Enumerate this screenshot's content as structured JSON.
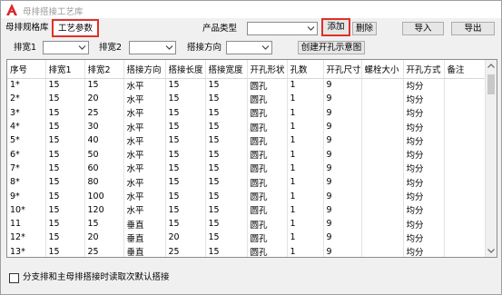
{
  "window": {
    "title": "母排搭接工艺库"
  },
  "tabs": [
    {
      "label": "母排规格库"
    },
    {
      "label": "工艺参数"
    }
  ],
  "toolbar": {
    "product_type_label": "产品类型",
    "product_type_value": "",
    "add_label": "添加",
    "delete_label": "删除",
    "import_label": "导入",
    "export_label": "导出"
  },
  "filters": {
    "width1_label": "排宽1",
    "width2_label": "排宽2",
    "direction_label": "搭接方向",
    "diagram_button": "创建开孔示意图"
  },
  "table": {
    "headers": [
      "序号",
      "排宽1",
      "排宽2",
      "搭接方向",
      "搭接长度",
      "搭接宽度",
      "开孔形状",
      "孔数",
      "开孔尺寸",
      "螺栓大小",
      "开孔方式",
      "备注"
    ],
    "rows": [
      [
        "1*",
        "15",
        "15",
        "水平",
        "15",
        "15",
        "圆孔",
        "1",
        "9",
        "",
        "均分",
        ""
      ],
      [
        "2*",
        "15",
        "20",
        "水平",
        "15",
        "15",
        "圆孔",
        "1",
        "9",
        "",
        "均分",
        ""
      ],
      [
        "3*",
        "15",
        "25",
        "水平",
        "15",
        "15",
        "圆孔",
        "1",
        "9",
        "",
        "均分",
        ""
      ],
      [
        "4*",
        "15",
        "30",
        "水平",
        "15",
        "15",
        "圆孔",
        "1",
        "9",
        "",
        "均分",
        ""
      ],
      [
        "5*",
        "15",
        "40",
        "水平",
        "15",
        "15",
        "圆孔",
        "1",
        "9",
        "",
        "均分",
        ""
      ],
      [
        "6*",
        "15",
        "50",
        "水平",
        "15",
        "15",
        "圆孔",
        "1",
        "9",
        "",
        "均分",
        ""
      ],
      [
        "7*",
        "15",
        "60",
        "水平",
        "15",
        "15",
        "圆孔",
        "1",
        "9",
        "",
        "均分",
        ""
      ],
      [
        "8*",
        "15",
        "80",
        "水平",
        "15",
        "15",
        "圆孔",
        "1",
        "9",
        "",
        "均分",
        ""
      ],
      [
        "9*",
        "15",
        "100",
        "水平",
        "15",
        "15",
        "圆孔",
        "1",
        "9",
        "",
        "均分",
        ""
      ],
      [
        "10*",
        "15",
        "120",
        "水平",
        "15",
        "15",
        "圆孔",
        "1",
        "9",
        "",
        "均分",
        ""
      ],
      [
        "11",
        "15",
        "15",
        "垂直",
        "15",
        "15",
        "圆孔",
        "1",
        "9",
        "",
        "均分",
        ""
      ],
      [
        "12*",
        "15",
        "20",
        "垂直",
        "20",
        "15",
        "圆孔",
        "1",
        "9",
        "",
        "均分",
        ""
      ],
      [
        "13*",
        "15",
        "25",
        "垂直",
        "25",
        "15",
        "圆孔",
        "1",
        "9",
        "",
        "均分",
        ""
      ]
    ]
  },
  "footer": {
    "checkbox_label": "分支排和主母排搭接时读取次默认搭接",
    "checked": false
  },
  "colors": {
    "highlight": "#e0302a",
    "app_icon": "#d9262c"
  }
}
